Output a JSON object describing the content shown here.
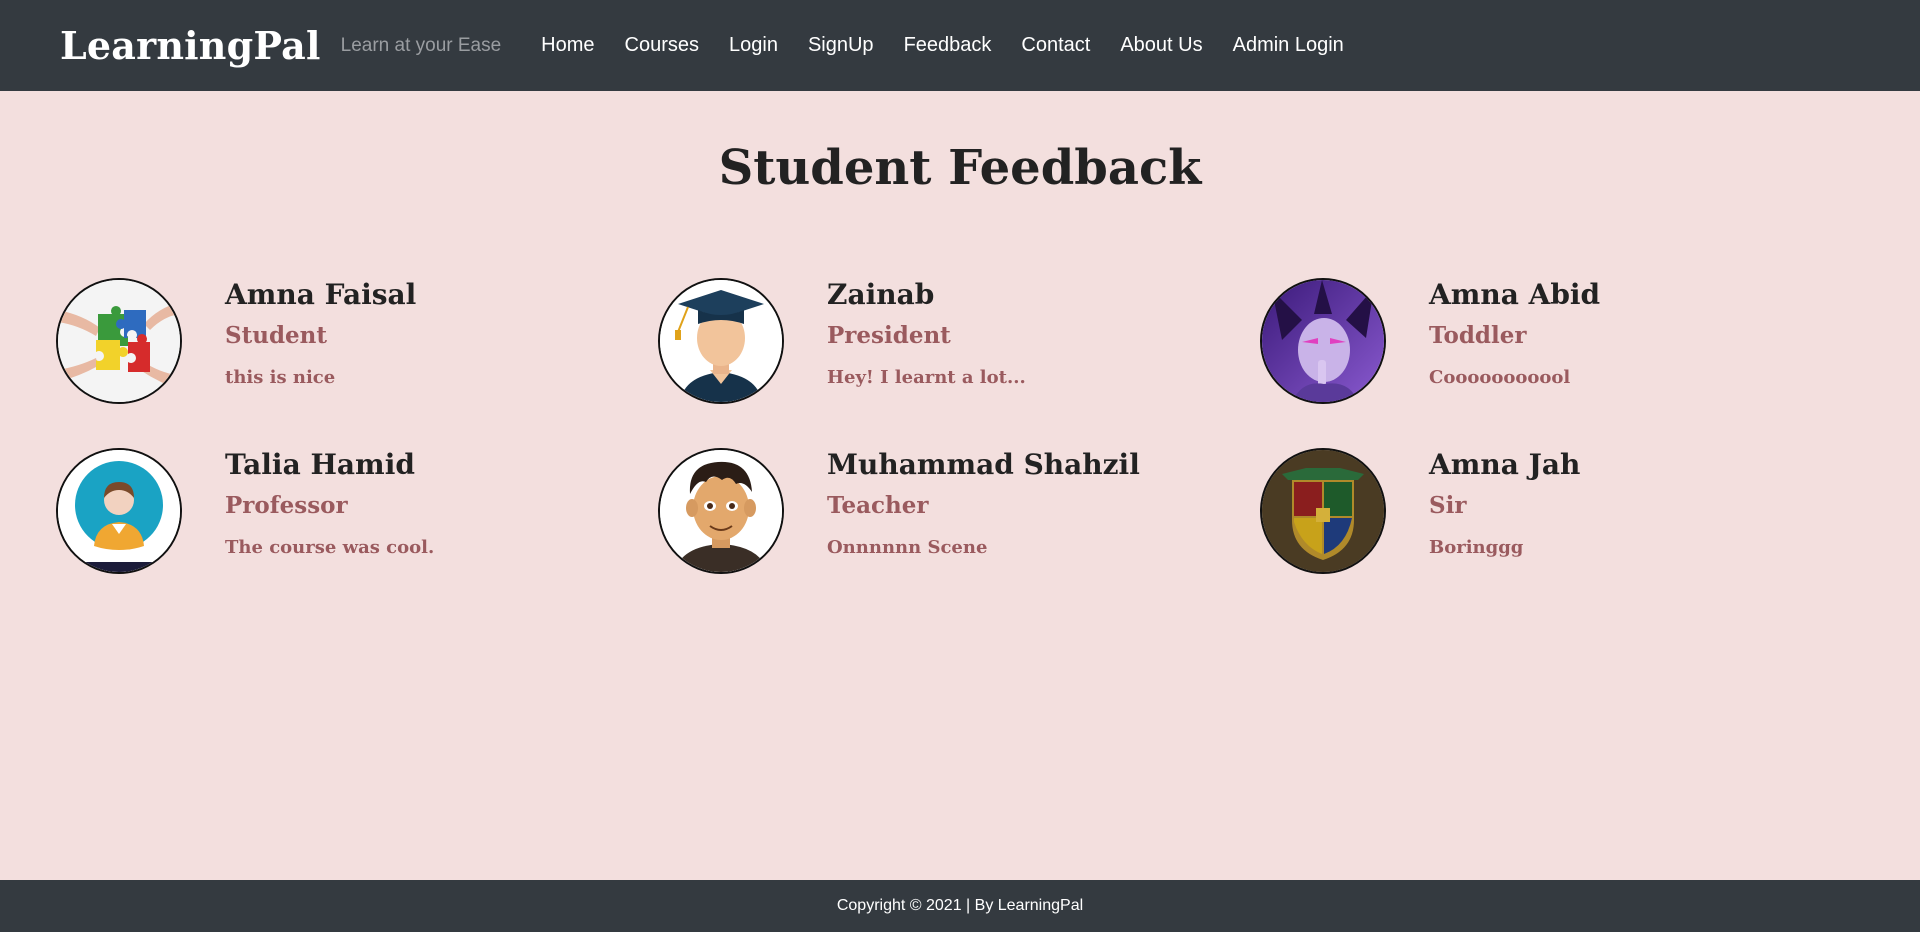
{
  "navbar": {
    "brand": "LearningPal",
    "tagline": "Learn at your Ease",
    "links": [
      "Home",
      "Courses",
      "Login",
      "SignUp",
      "Feedback",
      "Contact",
      "About Us",
      "Admin Login"
    ]
  },
  "page": {
    "heading": "Student Feedback"
  },
  "feedback": [
    {
      "name": "Amna Faisal",
      "role": "Student",
      "comment": "this is nice",
      "avatar_icon": "puzzle-pieces-icon"
    },
    {
      "name": "Zainab",
      "role": "President",
      "comment": "Hey! I learnt a lot...",
      "avatar_icon": "graduate-avatar-icon"
    },
    {
      "name": "Amna Abid",
      "role": "Toddler",
      "comment": "Cooooooooool",
      "avatar_icon": "anime-character-avatar-icon"
    },
    {
      "name": "Talia Hamid",
      "role": "Professor",
      "comment": "The course was cool.",
      "avatar_icon": "user-avatar-icon"
    },
    {
      "name": "Muhammad Shahzil",
      "role": "Teacher",
      "comment": "Onnnnnn Scene",
      "avatar_icon": "cartoon-man-avatar-icon"
    },
    {
      "name": "Amna Jah",
      "role": "Sir",
      "comment": "Boringgg",
      "avatar_icon": "crest-avatar-icon"
    }
  ],
  "footer": {
    "text": "Copyright © 2021 | By LearningPal"
  },
  "colors": {
    "navbar_bg": "#343a40",
    "page_bg": "#f3dfde",
    "accent_text": "#9a5a5e",
    "heading_text": "#222222"
  }
}
